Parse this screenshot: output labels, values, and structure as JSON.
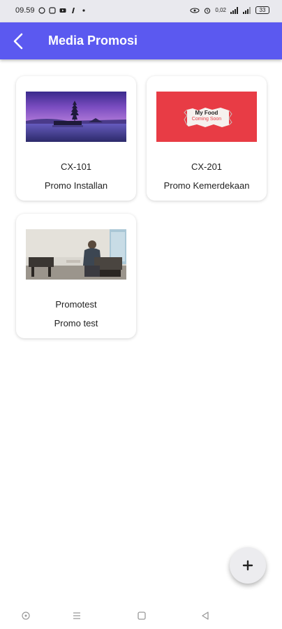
{
  "status_bar": {
    "time": "09.59",
    "network_speed": "0,02",
    "battery": "33"
  },
  "app_bar": {
    "title": "Media Promosi",
    "back_icon": "chevron-left-icon"
  },
  "promos": [
    {
      "code": "CX-101",
      "name": "Promo Installan",
      "image": "temple-lake-sunset"
    },
    {
      "code": "CX-201",
      "name": "Promo Kemerdekaan",
      "image": "torn-paper-red",
      "image_text_line1": "My Food",
      "image_text_line2": "Coming Soon"
    },
    {
      "code": "Promotest",
      "name": "Promo test",
      "image": "room-photo"
    }
  ],
  "fab": {
    "icon": "plus-icon"
  },
  "colors": {
    "app_bar": "#5b59f0",
    "red_promo": "#e83c45"
  }
}
